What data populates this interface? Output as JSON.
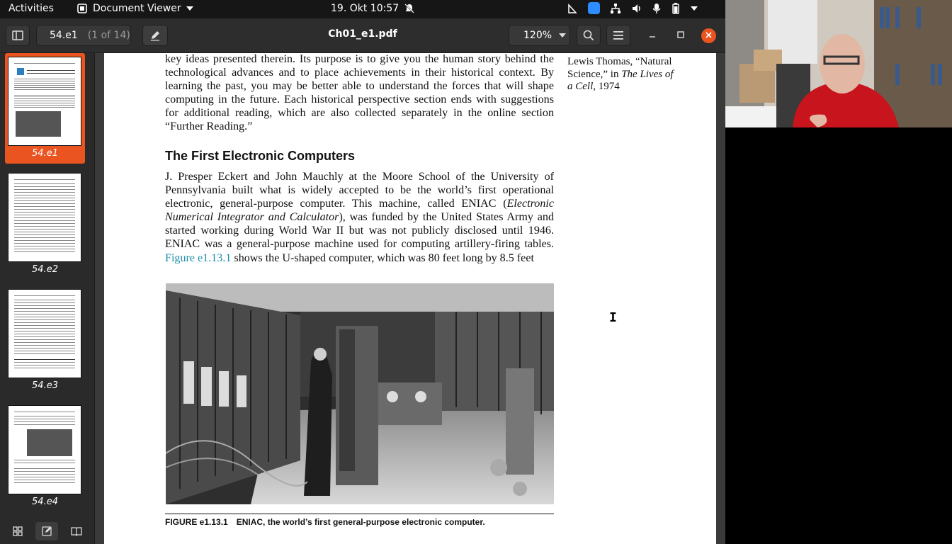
{
  "topbar": {
    "activities": "Activities",
    "app_name": "Document Viewer",
    "datetime": "19. Okt  10:57"
  },
  "window": {
    "page_entry": "54.e1",
    "page_count": "(1 of 14)",
    "title": "Ch01_e1.pdf",
    "zoom": "120%"
  },
  "sidebar": {
    "thumbnails": [
      {
        "label": "54.e1",
        "selected": true
      },
      {
        "label": "54.e2",
        "selected": false
      },
      {
        "label": "54.e3",
        "selected": false
      },
      {
        "label": "54.e4",
        "selected": false
      }
    ]
  },
  "document": {
    "para1": "key ideas presented therein. Its purpose is to give you the human story behind the technological advances and to place achievements in their historical context. By learning the past, you may be better able to understand the forces that will shape computing in the future. Each historical perspective section ends with suggestions for additional reading, which are also collected separately in the online section “Further Reading.”",
    "heading": "The First Electronic Computers",
    "para2_a": "J. Presper Eckert and John Mauchly at the Moore School of the University of Pennsylvania built what is widely accepted to be the world’s first operational electronic, general-purpose computer. This machine, called ENIAC (",
    "para2_italic": "Electronic Numerical Integrator and Calculator",
    "para2_b": "), was funded by the United States Army and started working during World War II but was not publicly disclosed until 1946. ENIAC was a general-purpose machine used for computing artillery-firing tables. ",
    "para2_link": "Figure e1.13.1",
    "para2_c": " shows the U-shaped computer, which was 80 feet long by 8.5 feet",
    "margin_a": "Lewis Thomas, “Natural Science,” in ",
    "margin_italic": "The Lives of a Cell",
    "margin_b": ", 1974",
    "caption_num": "FIGURE e1.13.1",
    "caption_text": "ENIAC, the world’s first general-purpose electronic computer."
  },
  "colors": {
    "accent": "#e95420",
    "link": "#1b8ea8"
  }
}
